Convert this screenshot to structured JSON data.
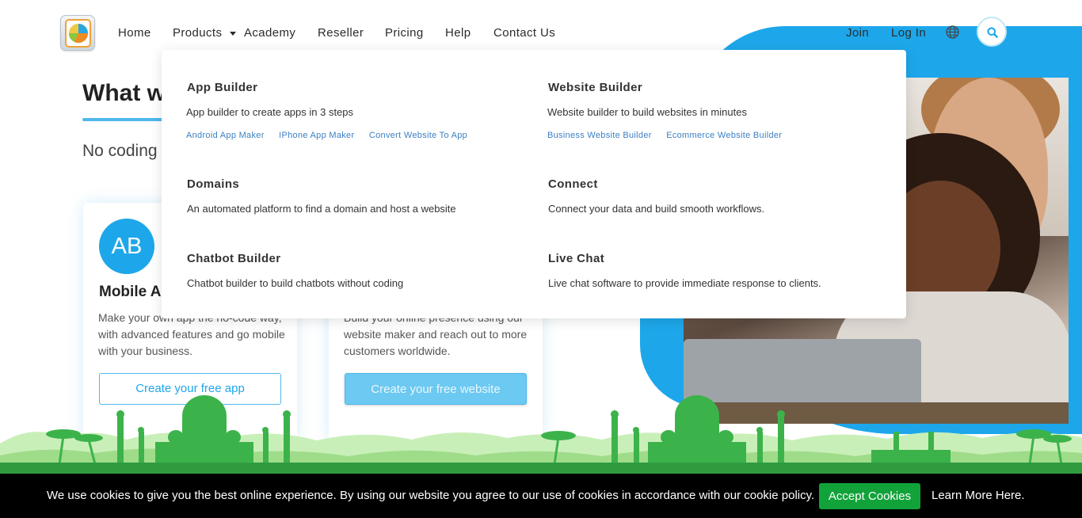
{
  "nav": {
    "items": [
      "Home",
      "Products",
      "Academy",
      "Reseller",
      "Pricing",
      "Help",
      "Contact Us"
    ],
    "join": "Join",
    "login": "Log In",
    "globe_icon": "globe-icon",
    "search_icon": "search-icon"
  },
  "hero": {
    "headline": "What w",
    "subline": "No coding",
    "cards": [
      {
        "avatar": "AB",
        "title": "Mobile A",
        "desc": "Make your own app the no-code way, with advanced features and go mobile with your business.",
        "button": "Create your free app"
      },
      {
        "desc": "Build your online presence using our website maker and reach out to more customers worldwide.",
        "button": "Create your free website"
      }
    ]
  },
  "dropdown": {
    "sections": [
      {
        "title": "App Builder",
        "desc": "App builder to create apps in 3 steps",
        "links": [
          "Android App Maker",
          "IPhone App Maker",
          "Convert Website To App"
        ]
      },
      {
        "title": "Website Builder",
        "desc": "Website builder to build websites in minutes",
        "links": [
          "Business Website Builder",
          "Ecommerce Website Builder"
        ]
      },
      {
        "title": "Domains",
        "desc": "An automated platform to find a domain and host a website",
        "links": []
      },
      {
        "title": "Connect",
        "desc": "Connect your data and build smooth workflows.",
        "links": []
      },
      {
        "title": "Chatbot Builder",
        "desc": "Chatbot builder to build chatbots without coding",
        "links": []
      },
      {
        "title": "Live Chat",
        "desc": "Live chat software to provide immediate response to clients.",
        "links": []
      }
    ]
  },
  "cookie": {
    "text": "We use cookies to give you the best online experience. By using our website you agree to our use of cookies in accordance with our cookie policy.",
    "accept": "Accept Cookies",
    "learn_more": "Learn More Here."
  },
  "colors": {
    "accent": "#1da7ea",
    "accept_green": "#12a23a",
    "mosque_green": "#3cb34a",
    "link_blue": "#3c7fc2"
  }
}
